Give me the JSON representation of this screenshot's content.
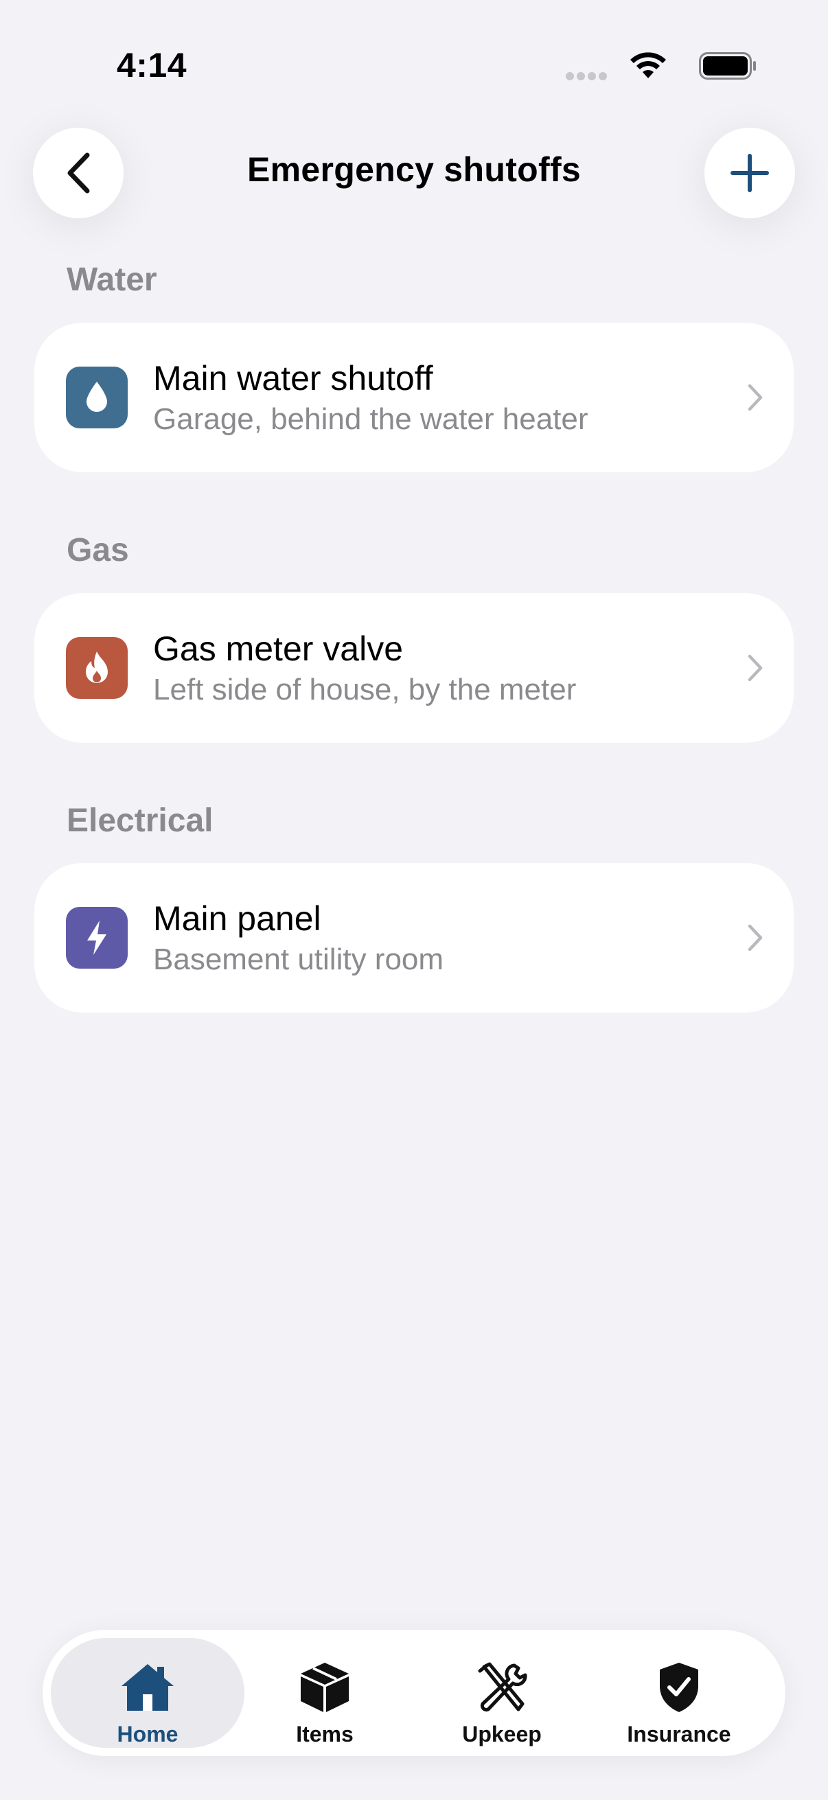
{
  "status_bar": {
    "time": "4:14"
  },
  "nav": {
    "title": "Emergency shutoffs"
  },
  "sections": [
    {
      "header": "Water",
      "item": {
        "title": "Main water shutoff",
        "subtitle": "Garage, behind the water heater",
        "icon": "water-drop-icon",
        "color": "#3f6e91"
      }
    },
    {
      "header": "Gas",
      "item": {
        "title": "Gas meter valve",
        "subtitle": "Left side of house, by the meter",
        "icon": "flame-icon",
        "color": "#b9573f"
      }
    },
    {
      "header": "Electrical",
      "item": {
        "title": "Main panel",
        "subtitle": "Basement utility room",
        "icon": "bolt-icon",
        "color": "#5f5aa8"
      }
    }
  ],
  "tabs": [
    {
      "label": "Home",
      "icon": "house-icon",
      "active": true
    },
    {
      "label": "Items",
      "icon": "box-icon",
      "active": false
    },
    {
      "label": "Upkeep",
      "icon": "tools-icon",
      "active": false
    },
    {
      "label": "Insurance",
      "icon": "shield-check-icon",
      "active": false
    }
  ],
  "colors": {
    "accent": "#1d4f7c",
    "background": "#f2f2f7",
    "secondary_text": "#8a8a8e"
  }
}
